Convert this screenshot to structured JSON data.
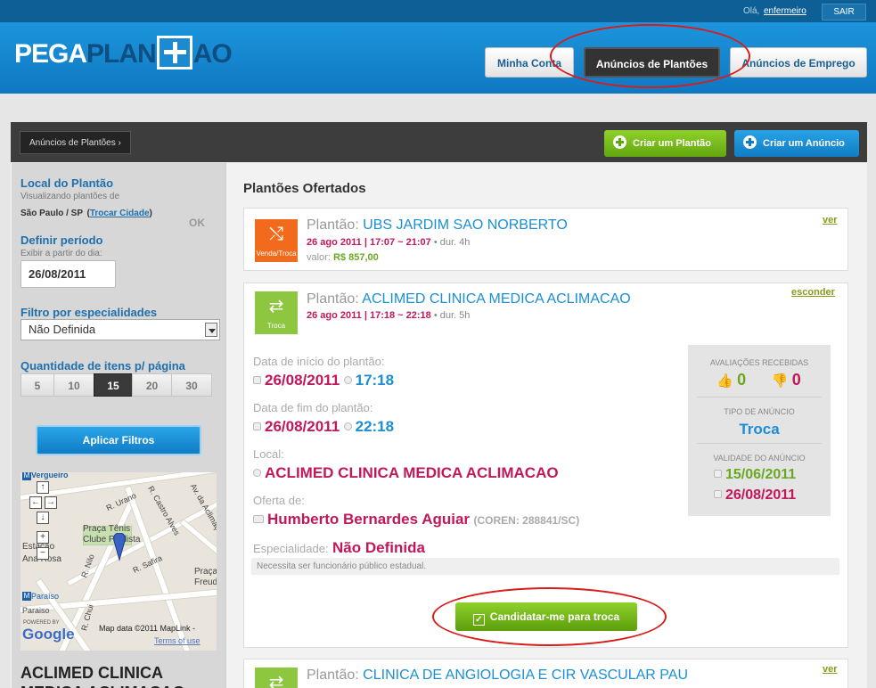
{
  "topbar": {
    "greeting": "Olá,",
    "user": "enfermeiro",
    "logout": "SAIR"
  },
  "header": {
    "logo_part1": "PEGA",
    "logo_part2": "PLAN",
    "logo_part3": "AO",
    "nav": [
      {
        "label": "Minha Conta"
      },
      {
        "label": "Anúncios de Plantões"
      },
      {
        "label": "Anúncios de Emprego"
      }
    ]
  },
  "toolbar": {
    "breadcrumb": "Anúncios de Plantões ›",
    "create_shift": "Criar um Plantão",
    "create_ad": "Criar um Anúncio"
  },
  "sidebar": {
    "location_title": "Local do Plantão",
    "location_sub": "Visualizando plantões de",
    "location_city": "São Paulo / SP",
    "change_city": "Trocar Cidade",
    "ok": "OK",
    "period_title": "Definir período",
    "period_sub": "Exibir a partir do dia:",
    "period_value": "26/08/2011",
    "specialty_title": "Filtro por especialidades",
    "specialty_value": "Não Definida",
    "per_page_title": "Quantidade de itens p/ página",
    "per_page": [
      "5",
      "10",
      "15",
      "20",
      "30"
    ],
    "per_page_selected": "15",
    "apply": "Aplicar Filtros",
    "map": {
      "labels": [
        "Vergueiro",
        "R. Urano",
        "R. Castro Alves",
        "Av. da Aclimação",
        "Praça Tênis",
        "Clube Paulista",
        "Estação",
        "Ana Rosa",
        "R. Safira",
        "R. Nilo",
        "Praça",
        "Freud",
        "Paraíso",
        "R. Chui",
        "Paraiso"
      ],
      "powered": "POWERED BY",
      "google": "Google",
      "mapdata": "Map data ©2011 MapLink -",
      "terms": "Terms of use"
    },
    "bottom_title": "ACLIMED CLINICA MEDICA ACLIMACAO"
  },
  "main": {
    "section_title": "Plantões Ofertados",
    "shift_label": "Plantão:",
    "cards": [
      {
        "type": "Venda/Troca",
        "name": "UBS JARDIM SAO NORBERTO",
        "datetime": "26 ago 2011 | 17:07 ~ 21:07",
        "duration": "• dur. 4h",
        "value_label": "valor:",
        "value": "R$ 857,00",
        "action": "ver",
        "color": "#f26a1b"
      },
      {
        "type": "Troca",
        "name": "ACLIMED CLINICA MEDICA ACLIMACAO",
        "datetime": "26 ago 2011 | 17:18 ~ 22:18",
        "duration": "• dur. 5h",
        "action": "esconder",
        "color": "#8dc63f"
      },
      {
        "type": "Troca",
        "name": "CLINICA DE ANGIOLOGIA E CIR VASCULAR PAU",
        "action": "ver",
        "color": "#8dc63f"
      }
    ],
    "detail": {
      "start_label": "Data de início do plantão:",
      "start_date": "26/08/2011",
      "start_time": "17:18",
      "end_label": "Data de fim do plantão:",
      "end_date": "26/08/2011",
      "end_time": "22:18",
      "place_label": "Local:",
      "place": "ACLIMED CLINICA MEDICA ACLIMACAO",
      "offer_label": "Oferta de:",
      "offer_name": "Humberto Bernardes Aguiar",
      "offer_coren": "(COREN: 288841/SC)",
      "specialty_label": "Especialidade:",
      "specialty": "Não Definida",
      "note": "Necessita ser funcionário público estadual.",
      "ratings_title": "AVALIAÇÕES RECEBIDAS",
      "ratings_up": "0",
      "ratings_down": "0",
      "ad_type_title": "TIPO DE ANÚNCIO",
      "ad_type": "Troca",
      "validity_title": "VALIDADE DO ANÚNCIO",
      "valid_from": "15/06/2011",
      "valid_to": "26/08/2011",
      "apply_button": "Candidatar-me para troca"
    }
  }
}
